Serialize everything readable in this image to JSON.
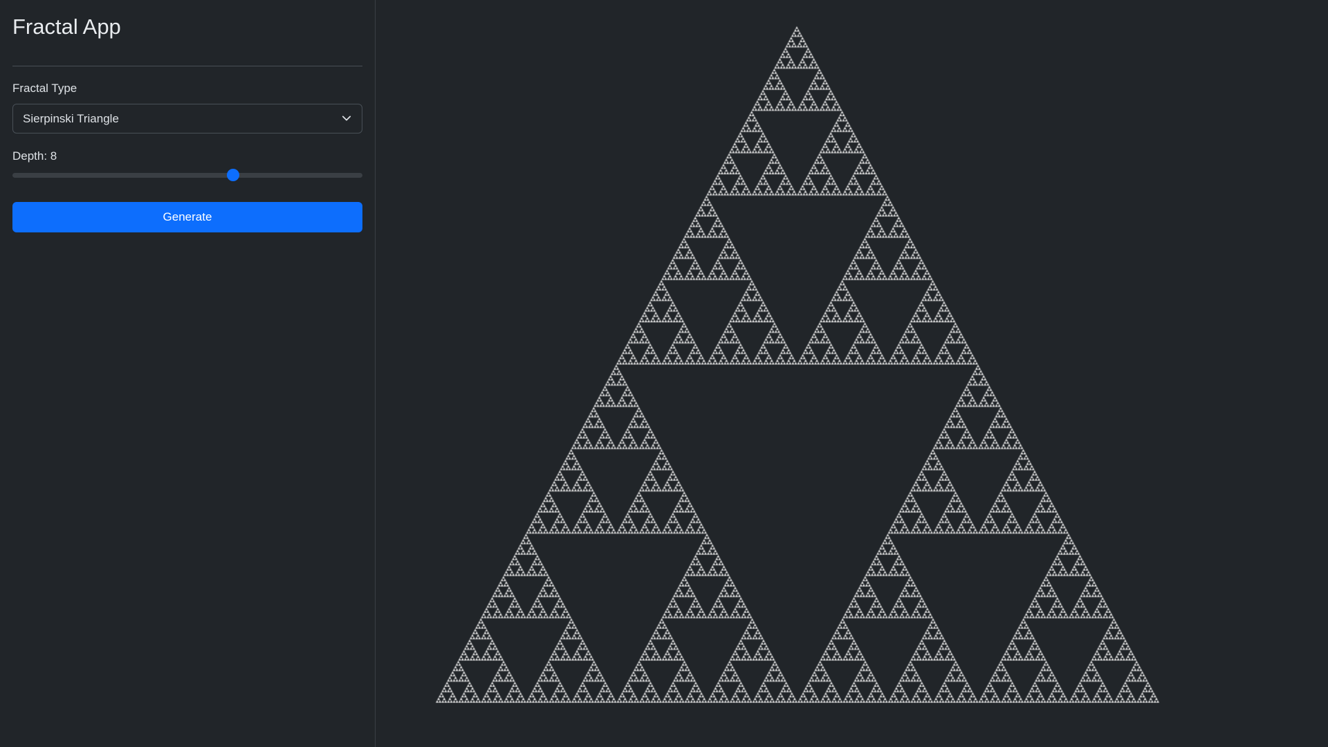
{
  "app": {
    "title": "Fractal App"
  },
  "controls": {
    "fractal_type_label": "Fractal Type",
    "fractal_type_selected": "Sierpinski Triangle",
    "depth_label": "Depth: 8",
    "depth_value": 8,
    "depth_fraction": 0.63,
    "generate_label": "Generate"
  },
  "fractal": {
    "type": "Sierpinski Triangle",
    "depth": 8,
    "fill_color": "#e0e0e0",
    "background_color": "#212529"
  },
  "colors": {
    "accent": "#0d6efd",
    "background": "#212529",
    "border": "#495057",
    "text": "#dee2e6"
  },
  "icons": {
    "select_chevron": "chevron-down-icon"
  }
}
